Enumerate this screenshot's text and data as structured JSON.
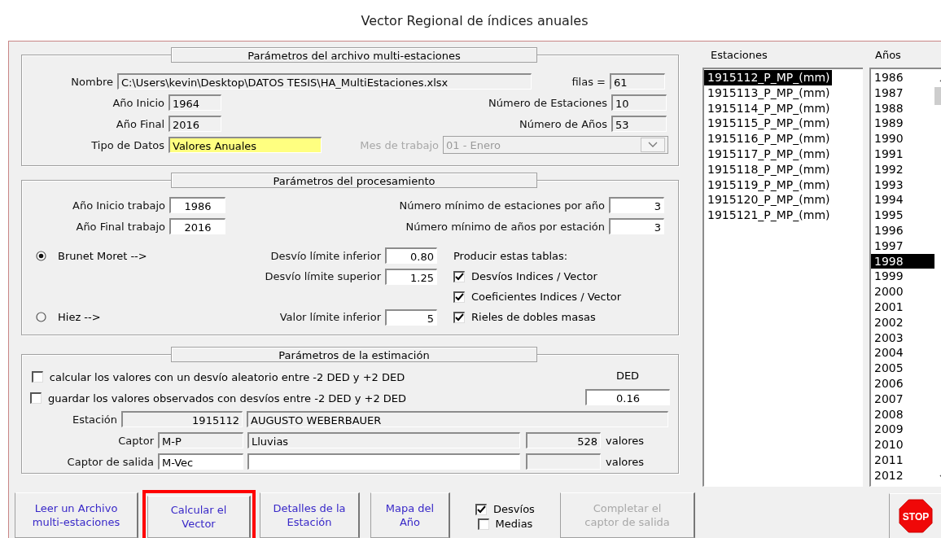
{
  "window": {
    "title": "Vector Regional de índices anuales"
  },
  "file_group": {
    "title": "Parámetros del archivo multi-estaciones",
    "nombre": {
      "label": "Nombre",
      "value": "C:\\Users\\kevin\\Desktop\\DATOS TESIS\\HA_MultiEstaciones.xlsx"
    },
    "filas": {
      "label": "filas =",
      "value": "61"
    },
    "ano_inicio": {
      "label": "Año Inicio",
      "value": "1964"
    },
    "num_estaciones": {
      "label": "Número de Estaciones",
      "value": "10"
    },
    "ano_final": {
      "label": "Año Final",
      "value": "2016"
    },
    "num_anos": {
      "label": "Número de Años",
      "value": "53"
    },
    "tipo_datos": {
      "label": "Tipo de Datos",
      "value": "Valores Anuales"
    },
    "mes_trabajo": {
      "label": "Mes de trabajo",
      "value": "01 - Enero",
      "disabled": true
    }
  },
  "proc_group": {
    "title": "Parámetros del procesamiento",
    "ano_inicio": {
      "label": "Año Inicio trabajo",
      "value": "1986"
    },
    "min_estaciones": {
      "label": "Número mínimo de estaciones por año",
      "value": "3"
    },
    "ano_final": {
      "label": "Año Final trabajo",
      "value": "2016"
    },
    "min_anos": {
      "label": "Número mínimo de años por estación",
      "value": "3"
    },
    "methods": [
      {
        "label": "Brunet Moret -->",
        "selected": true
      },
      {
        "label": "Hiez -->",
        "selected": false
      }
    ],
    "desvio_inf": {
      "label": "Desvío límite inferior",
      "value": "0.80"
    },
    "desvio_sup": {
      "label": "Desvío límite superior",
      "value": "1.25"
    },
    "valor_inf": {
      "label": "Valor límite inferior",
      "value": "5"
    },
    "tables_label": "Producir estas tablas:",
    "tables": [
      {
        "label": "Desvíos Indices / Vector",
        "checked": true
      },
      {
        "label": "Coeficientes Indices / Vector",
        "checked": true
      },
      {
        "label": "Rieles de dobles masas",
        "checked": true
      }
    ]
  },
  "est_group": {
    "title": "Parámetros de la estimación",
    "options": [
      {
        "label": "calcular los valores con un desvío aleatorio entre -2 DED y +2 DED",
        "checked": false
      },
      {
        "label": "guardar los valores observados con desvíos entre -2 DED y +2 DED",
        "checked": false
      }
    ],
    "ded": {
      "label": "DED",
      "value": "0.16"
    },
    "estacion": {
      "label": "Estación",
      "code": "1915112",
      "name": "AUGUSTO WEBERBAUER"
    },
    "captor": {
      "label": "Captor",
      "code": "M-P",
      "description": "Lluvias",
      "count": "528",
      "unit": "valores"
    },
    "captor_salida": {
      "label": "Captor de salida",
      "code": "M-Vec",
      "unit": "valores"
    }
  },
  "buttons": [
    {
      "label": "Leer un Archivo\nmulti-estaciones",
      "disabled": false,
      "highlighted": false
    },
    {
      "label": "Calcular el\nVector",
      "disabled": false,
      "highlighted": true
    },
    {
      "label": "Detalles de la\nEstación",
      "disabled": false,
      "highlighted": false
    },
    {
      "label": "Mapa del\nAño",
      "disabled": false,
      "highlighted": false
    }
  ],
  "view_options": [
    {
      "label": "Desvíos",
      "checked": true
    },
    {
      "label": "Medias",
      "checked": false
    }
  ],
  "complete_button": {
    "label": "Completar el\ncaptor de salida",
    "disabled": true
  },
  "stop": {
    "label": "STOP"
  },
  "stations": {
    "title": "Estaciones",
    "items": [
      {
        "label": "1915112_P_MP_(mm)",
        "selected": true
      },
      {
        "label": "1915113_P_MP_(mm)",
        "selected": false
      },
      {
        "label": "1915114_P_MP_(mm)",
        "selected": false
      },
      {
        "label": "1915115_P_MP_(mm)",
        "selected": false
      },
      {
        "label": "1915116_P_MP_(mm)",
        "selected": false
      },
      {
        "label": "1915117_P_MP_(mm)",
        "selected": false
      },
      {
        "label": "1915118_P_MP_(mm)",
        "selected": false
      },
      {
        "label": "1915119_P_MP_(mm)",
        "selected": false
      },
      {
        "label": "1915120_P_MP_(mm)",
        "selected": false
      },
      {
        "label": "1915121_P_MP_(mm)",
        "selected": false
      }
    ]
  },
  "years": {
    "title": "Años",
    "items": [
      {
        "label": "1986",
        "selected": false
      },
      {
        "label": "1987",
        "selected": false
      },
      {
        "label": "1988",
        "selected": false
      },
      {
        "label": "1989",
        "selected": false
      },
      {
        "label": "1990",
        "selected": false
      },
      {
        "label": "1991",
        "selected": false
      },
      {
        "label": "1992",
        "selected": false
      },
      {
        "label": "1993",
        "selected": false
      },
      {
        "label": "1994",
        "selected": false
      },
      {
        "label": "1995",
        "selected": false
      },
      {
        "label": "1996",
        "selected": false
      },
      {
        "label": "1997",
        "selected": false
      },
      {
        "label": "1998",
        "selected": true
      },
      {
        "label": "1999",
        "selected": false
      },
      {
        "label": "2000",
        "selected": false
      },
      {
        "label": "2001",
        "selected": false
      },
      {
        "label": "2002",
        "selected": false
      },
      {
        "label": "2003",
        "selected": false
      },
      {
        "label": "2004",
        "selected": false
      },
      {
        "label": "2005",
        "selected": false
      },
      {
        "label": "2006",
        "selected": false
      },
      {
        "label": "2007",
        "selected": false
      },
      {
        "label": "2008",
        "selected": false
      },
      {
        "label": "2009",
        "selected": false
      },
      {
        "label": "2010",
        "selected": false
      },
      {
        "label": "2011",
        "selected": false
      },
      {
        "label": "2012",
        "selected": false
      }
    ]
  }
}
